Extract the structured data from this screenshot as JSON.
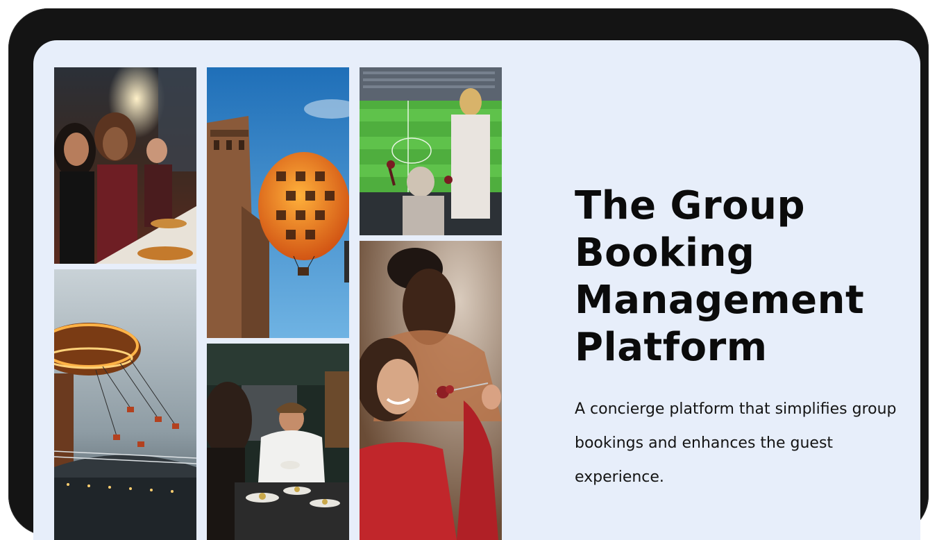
{
  "hero": {
    "title_lines": [
      "The Group",
      "Booking",
      "Management",
      "Platform"
    ],
    "subtitle": "A concierge platform that simplifies group bookings and enhances the guest experience."
  },
  "gallery": {
    "photos": [
      {
        "name": "friends-dining-photo"
      },
      {
        "name": "hot-air-balloon-photo"
      },
      {
        "name": "stadium-hospitality-photo"
      },
      {
        "name": "swing-ride-photo"
      },
      {
        "name": "chef-kitchen-photo"
      },
      {
        "name": "woman-eating-photo"
      }
    ]
  },
  "colors": {
    "screen_background": "#e7eefa",
    "device_frame": "#141414",
    "title_text": "#0b0b0b"
  }
}
